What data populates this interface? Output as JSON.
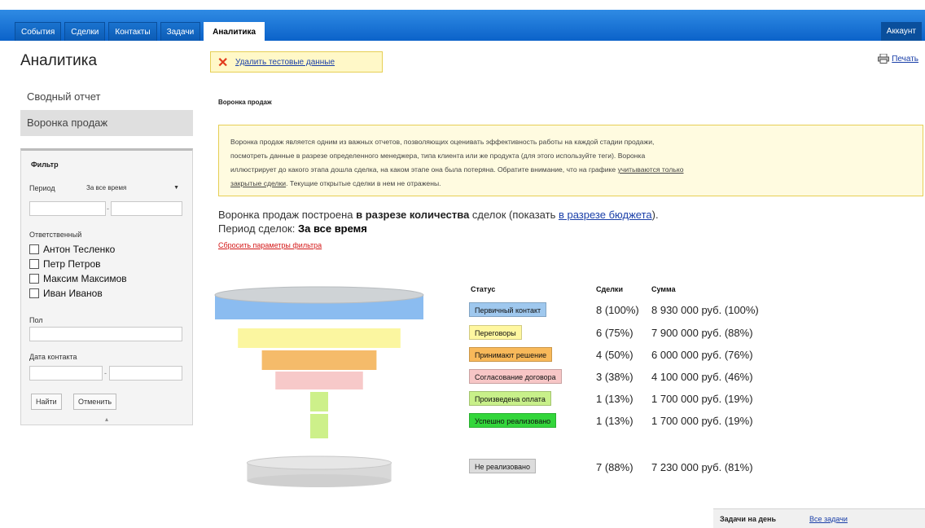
{
  "nav": {
    "tabs": [
      "События",
      "Сделки",
      "Контакты",
      "Задачи",
      "Аналитика"
    ],
    "active_tab": "Аналитика",
    "account": "Аккаунт"
  },
  "sidebar": {
    "title": "Аналитика",
    "items": [
      {
        "label": "Сводный отчет",
        "active": false
      },
      {
        "label": "Воронка продаж",
        "active": true
      }
    ],
    "filter": {
      "title": "Фильтр",
      "period_label": "Период",
      "period_value": "За все время",
      "responsible_label": "Ответственный",
      "users": [
        "Антон Тесленко",
        "Петр Петров",
        "Максим Максимов",
        "Иван Иванов"
      ],
      "gender_label": "Пол",
      "contact_date_label": "Дата контакта",
      "find_button": "Найти",
      "cancel_button": "Отменить"
    }
  },
  "toolbar": {
    "delete_test_data": "Удалить тестовые данные",
    "print": "Печать"
  },
  "report": {
    "section_title": "Воронка продаж",
    "info_text_1": "Воронка продаж является одним из важных отчетов, позволяющих оценивать эффективность работы на каждой стадии продажи,",
    "info_text_2": "посмотреть данные в разрезе определенного менеджера, типа клиента или же продукта (для этого используйте теги). Воронка",
    "info_text_3": "иллюстрирует до какого этапа дошла сделка, на каком этапе она была потеряна. Обратите внимание, что на графике",
    "info_link_a": "учитываются только",
    "info_link_b": "закрытые сделки",
    "info_text_4": ". Текущие открытые сделки в нем не отражены.",
    "summary_prefix": "Воронка продаж построена ",
    "summary_bold": "в разрезе количества",
    "summary_mid": " сделок (показать ",
    "summary_link": "в разрезе бюджета",
    "summary_suffix": ").",
    "period_prefix": "Период сделок: ",
    "period_value": "За все время",
    "reset_filter": "Сбросить параметры фильтра"
  },
  "funnel_table": {
    "headers": {
      "status": "Статус",
      "deals": "Сделки",
      "sum": "Сумма"
    },
    "rows": [
      {
        "status": "Первичный контакт",
        "color": "#9fc8ee",
        "deals": "8 (100%)",
        "sum": "8 930 000 руб. (100%)"
      },
      {
        "status": "Переговоры",
        "color": "#fff7a0",
        "deals": "6 (75%)",
        "sum": "7 900 000 руб. (88%)"
      },
      {
        "status": "Принимают решение",
        "color": "#f8b95a",
        "deals": "4 (50%)",
        "sum": "6 000 000 руб. (76%)"
      },
      {
        "status": "Согласование договора",
        "color": "#f7c6c6",
        "deals": "3 (38%)",
        "sum": "4 100 000 руб. (46%)"
      },
      {
        "status": "Произведена оплата",
        "color": "#c8f08a",
        "deals": "1 (13%)",
        "sum": "1 700 000 руб. (19%)"
      },
      {
        "status": "Успешно реализовано",
        "color": "#33d63b",
        "deals": "1 (13%)",
        "sum": "1 700 000 руб. (19%)"
      }
    ],
    "lost": {
      "status": "Не реализовано",
      "color": "#dcdcdc",
      "deals": "7 (88%)",
      "sum": "7 230 000 руб. (81%)"
    }
  },
  "funnel_chart": {
    "stage_values": [
      8,
      6,
      4,
      3,
      1,
      1
    ],
    "stage_colors": [
      "#8bbcf0",
      "#fbf6a0",
      "#f5bb6a",
      "#f7c9c9",
      "#cdf08a",
      "#cdf08a"
    ],
    "lost_value": 7,
    "lost_color": "#d8d8d8"
  },
  "tasks_bar": {
    "label": "Задачи на день",
    "link": "Все задачи"
  }
}
